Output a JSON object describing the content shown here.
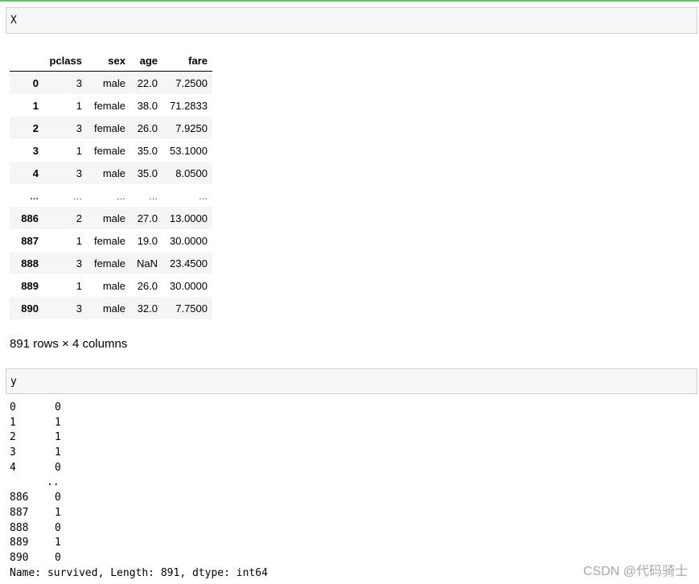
{
  "cells": {
    "x_input": "X",
    "y_input": "y"
  },
  "dataframe": {
    "columns": [
      "pclass",
      "sex",
      "age",
      "fare"
    ],
    "rows": [
      {
        "index": "0",
        "pclass": "3",
        "sex": "male",
        "age": "22.0",
        "fare": "7.2500"
      },
      {
        "index": "1",
        "pclass": "1",
        "sex": "female",
        "age": "38.0",
        "fare": "71.2833"
      },
      {
        "index": "2",
        "pclass": "3",
        "sex": "female",
        "age": "26.0",
        "fare": "7.9250"
      },
      {
        "index": "3",
        "pclass": "1",
        "sex": "female",
        "age": "35.0",
        "fare": "53.1000"
      },
      {
        "index": "4",
        "pclass": "3",
        "sex": "male",
        "age": "35.0",
        "fare": "8.0500"
      },
      {
        "index": "...",
        "pclass": "...",
        "sex": "...",
        "age": "...",
        "fare": "..."
      },
      {
        "index": "886",
        "pclass": "2",
        "sex": "male",
        "age": "27.0",
        "fare": "13.0000"
      },
      {
        "index": "887",
        "pclass": "1",
        "sex": "female",
        "age": "19.0",
        "fare": "30.0000"
      },
      {
        "index": "888",
        "pclass": "3",
        "sex": "female",
        "age": "NaN",
        "fare": "23.4500"
      },
      {
        "index": "889",
        "pclass": "1",
        "sex": "male",
        "age": "26.0",
        "fare": "30.0000"
      },
      {
        "index": "890",
        "pclass": "3",
        "sex": "male",
        "age": "32.0",
        "fare": "7.7500"
      }
    ],
    "summary": "891 rows × 4 columns"
  },
  "series": {
    "rows": [
      {
        "index": "0",
        "value": "0"
      },
      {
        "index": "1",
        "value": "1"
      },
      {
        "index": "2",
        "value": "1"
      },
      {
        "index": "3",
        "value": "1"
      },
      {
        "index": "4",
        "value": "0"
      }
    ],
    "ellipsis": "..",
    "rows_tail": [
      {
        "index": "886",
        "value": "0"
      },
      {
        "index": "887",
        "value": "1"
      },
      {
        "index": "888",
        "value": "0"
      },
      {
        "index": "889",
        "value": "1"
      },
      {
        "index": "890",
        "value": "0"
      }
    ],
    "footer": "Name: survived, Length: 891, dtype: int64"
  },
  "watermark": "CSDN @代码骑士",
  "colors": {
    "top_border": "#6bbf6b",
    "input_bg": "#f7f7f7",
    "row_stripe": "#f5f5f5"
  }
}
